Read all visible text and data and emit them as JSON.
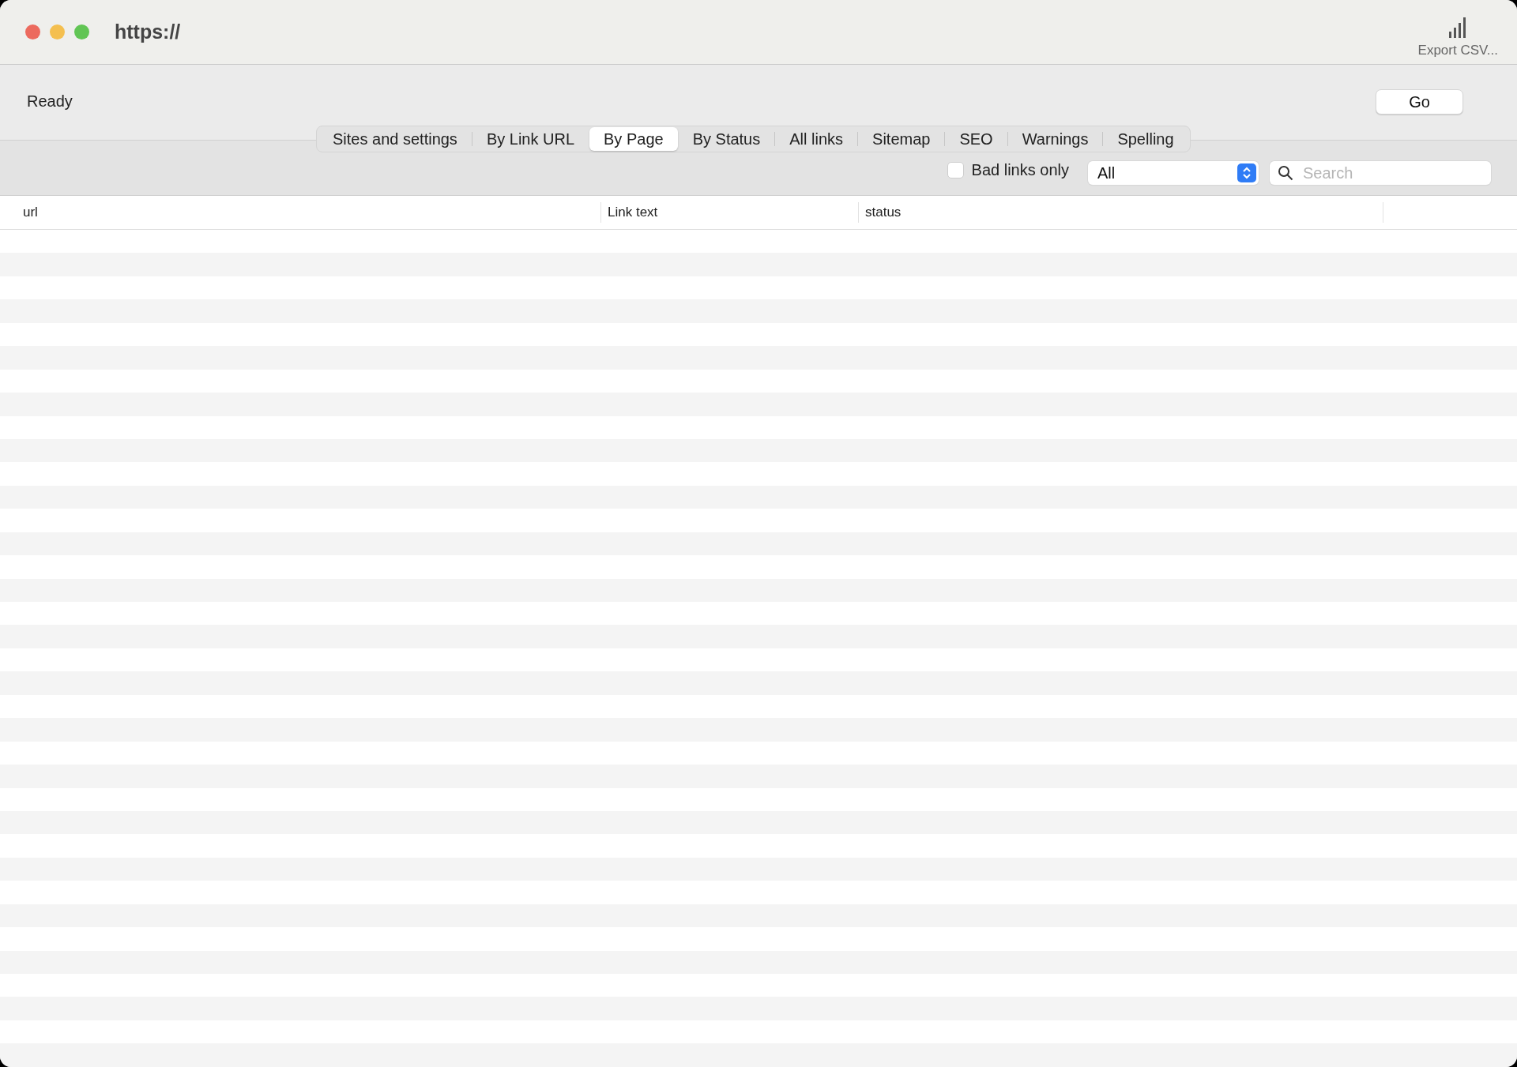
{
  "window": {
    "title": "https://"
  },
  "toolbar": {
    "export": {
      "label": "Export CSV..."
    }
  },
  "status": "Ready",
  "go_button": {
    "label": "Go"
  },
  "tabs": [
    {
      "label": "Sites and settings",
      "selected": false
    },
    {
      "label": "By Link URL",
      "selected": false
    },
    {
      "label": "By Page",
      "selected": true
    },
    {
      "label": "By Status",
      "selected": false
    },
    {
      "label": "All links",
      "selected": false
    },
    {
      "label": "Sitemap",
      "selected": false
    },
    {
      "label": "SEO",
      "selected": false
    },
    {
      "label": "Warnings",
      "selected": false
    },
    {
      "label": "Spelling",
      "selected": false
    }
  ],
  "filters": {
    "bad_links_only": {
      "label": "Bad links only",
      "checked": false
    },
    "dropdown": {
      "value": "All"
    },
    "search": {
      "placeholder": "Search"
    }
  },
  "table": {
    "columns": [
      "url",
      "Link text",
      "status"
    ]
  }
}
